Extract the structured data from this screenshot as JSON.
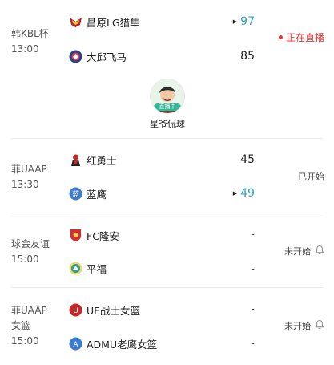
{
  "matches": [
    {
      "league": "韩KBL杯",
      "time": "13:00",
      "home": {
        "name": "昌原LG猎隼",
        "score": "97",
        "logo": "lg-sakers-logo",
        "color": "#b3262d"
      },
      "away": {
        "name": "大邱飞马",
        "score": "85",
        "logo": "daegu-pegasus-logo",
        "color": "#26428b"
      },
      "status": "正在直播",
      "streamer": {
        "name": "星爷侃球",
        "tag": "直播中"
      }
    },
    {
      "league": "菲UAAP",
      "time": "13:30",
      "home": {
        "name": "红勇士",
        "score": "45",
        "logo": "red-warriors-logo",
        "color": "#c62828"
      },
      "away": {
        "name": "蓝鹰",
        "score": "49",
        "logo": "blue-eagles-logo",
        "color": "#3d7bd0",
        "logo_text": "蓝"
      },
      "status": "已开始"
    },
    {
      "league": "球会友谊",
      "time": "15:00",
      "home": {
        "name": "FC隆安",
        "score": "-",
        "logo": "fc-longan-logo",
        "color": "#d32f2f"
      },
      "away": {
        "name": "平福",
        "score": "-",
        "logo": "binh-phuoc-logo",
        "color": "#2f9e8f"
      },
      "status": "未开始"
    },
    {
      "league": "菲UAAP",
      "league2": "女篮",
      "time": "15:00",
      "home": {
        "name": "UE战士女篮",
        "score": "-",
        "logo": "ue-warriors-logo",
        "color": "#c62828",
        "logo_text": "U"
      },
      "away": {
        "name": "ADMU老鹰女篮",
        "score": "-",
        "logo": "admu-eagles-logo",
        "color": "#3d7bd0",
        "logo_text": "A"
      },
      "status": "未开始"
    }
  ]
}
